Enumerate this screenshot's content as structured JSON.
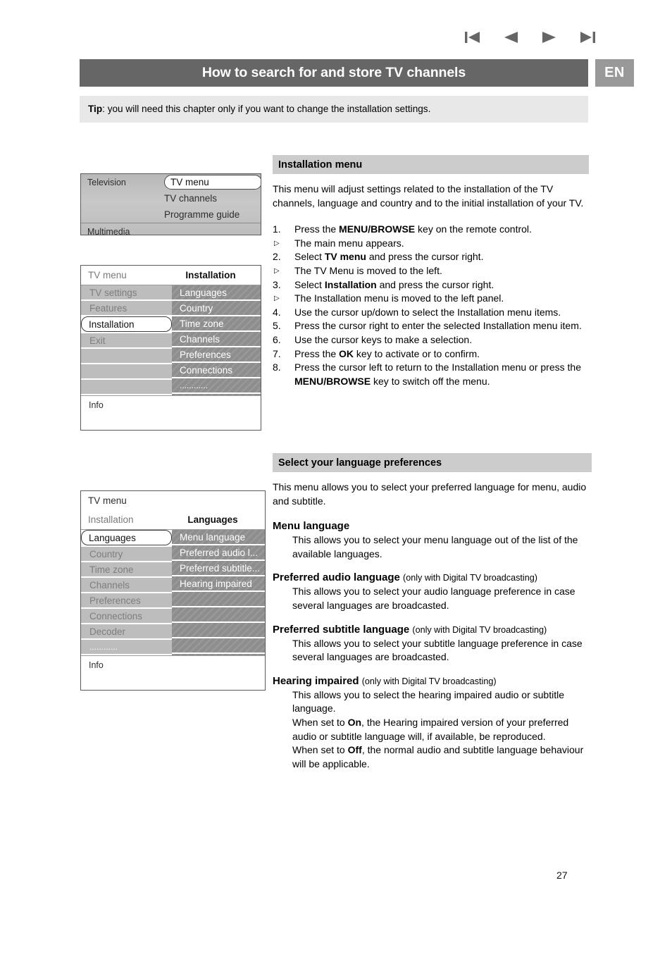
{
  "topnav": {
    "buttons": [
      {
        "name": "skip-back-icon",
        "label": "First page"
      },
      {
        "name": "previous-icon",
        "label": "Previous page"
      },
      {
        "name": "next-icon",
        "label": "Next page"
      },
      {
        "name": "skip-forward-icon",
        "label": "Last page"
      }
    ]
  },
  "header": {
    "title": "How to search for and store TV channels",
    "language_badge": "EN",
    "bar_color": "#666666",
    "badge_color": "#999999"
  },
  "tip": {
    "label": "Tip",
    "separator": ": ",
    "text": "you will need this chapter only if you want to change the installation settings.",
    "background": "#e8e8e8"
  },
  "osd_television": {
    "rows": [
      {
        "left": "Television",
        "right": "TV menu",
        "selected": true
      },
      {
        "left": "",
        "right": "TV channels",
        "selected": false
      },
      {
        "left": "",
        "right": "Programme guide",
        "selected": false
      }
    ],
    "second_group_label": "Multimedia"
  },
  "osd_installation": {
    "title_left": "TV menu",
    "title_right": "Installation",
    "left_items": [
      {
        "label": "TV settings",
        "selected": false
      },
      {
        "label": "Features",
        "selected": false
      },
      {
        "label": "Installation",
        "selected": true
      },
      {
        "label": "Exit",
        "selected": false
      },
      {
        "label": "",
        "selected": false
      },
      {
        "label": "",
        "selected": false
      },
      {
        "label": "",
        "selected": false
      }
    ],
    "right_items": [
      "Languages",
      "Country",
      "Time zone",
      "Channels",
      "Preferences",
      "Connections",
      "............"
    ],
    "info_label": "Info"
  },
  "osd_languages": {
    "title_top": "TV menu",
    "title_left": "Installation",
    "title_right": "Languages",
    "left_items": [
      {
        "label": "Languages",
        "selected": true
      },
      {
        "label": "Country",
        "selected": false
      },
      {
        "label": "Time zone",
        "selected": false
      },
      {
        "label": "Channels",
        "selected": false
      },
      {
        "label": "Preferences",
        "selected": false
      },
      {
        "label": "Connections",
        "selected": false
      },
      {
        "label": "Decoder",
        "selected": false
      },
      {
        "label": "............",
        "selected": false
      }
    ],
    "right_items": [
      "Menu language",
      "Preferred audio l...",
      "Preferred subtitle...",
      "Hearing impaired",
      "",
      "",
      "",
      ""
    ],
    "info_label": "Info"
  },
  "installation_section": {
    "heading": "Installation menu",
    "intro": "This menu will adjust settings related to the installation of the TV channels, language and country and to the initial installation of your TV.",
    "steps": [
      {
        "num": "1.",
        "parts": [
          {
            "text": "Press the ",
            "bold": false
          },
          {
            "text": "MENU/BROWSE",
            "bold": true
          },
          {
            "text": " key on the remote control.",
            "bold": false
          }
        ],
        "sub": "The main menu appears."
      },
      {
        "num": "2.",
        "parts": [
          {
            "text": "Select ",
            "bold": false
          },
          {
            "text": "TV menu",
            "bold": true
          },
          {
            "text": " and press the cursor right.",
            "bold": false
          }
        ],
        "sub": "The TV Menu is moved to the left."
      },
      {
        "num": "3.",
        "parts": [
          {
            "text": "Select ",
            "bold": false
          },
          {
            "text": "Installation",
            "bold": true
          },
          {
            "text": " and press the cursor right.",
            "bold": false
          }
        ],
        "sub": "The Installation menu is moved to the left panel."
      },
      {
        "num": "4.",
        "parts": [
          {
            "text": "Use the cursor up/down to select the Installation menu items.",
            "bold": false
          }
        ],
        "sub": ""
      },
      {
        "num": "5.",
        "parts": [
          {
            "text": "Press the cursor right to enter the selected Installation menu item.",
            "bold": false
          }
        ],
        "sub": ""
      },
      {
        "num": "6.",
        "parts": [
          {
            "text": "Use the cursor keys to make a selection.",
            "bold": false
          }
        ],
        "sub": ""
      },
      {
        "num": "7.",
        "parts": [
          {
            "text": "Press the ",
            "bold": false
          },
          {
            "text": "OK",
            "bold": true
          },
          {
            "text": " key to activate or to confirm.",
            "bold": false
          }
        ],
        "sub": ""
      },
      {
        "num": "8.",
        "parts": [
          {
            "text": "Press the cursor left to return to the Installation menu or press the ",
            "bold": false
          },
          {
            "text": "MENU/BROWSE",
            "bold": true
          },
          {
            "text": " key to switch off the menu.",
            "bold": false
          }
        ],
        "sub": ""
      }
    ]
  },
  "language_section": {
    "heading": "Select your language preferences",
    "intro": "This menu allows you to select your preferred language for menu, audio and subtitle.",
    "definitions": [
      {
        "term": "Menu language",
        "note": "",
        "body": [
          {
            "parts": [
              {
                "text": "This allows you to select your menu language out of the list of the available languages.",
                "bold": false
              }
            ]
          }
        ]
      },
      {
        "term": "Preferred audio language",
        "note": "(only with Digital TV broadcasting)",
        "body": [
          {
            "parts": [
              {
                "text": "This allows you to select your audio language preference in case several languages are broadcasted.",
                "bold": false
              }
            ]
          }
        ]
      },
      {
        "term": "Preferred subtitle language",
        "note": "(only with Digital TV broadcasting)",
        "body": [
          {
            "parts": [
              {
                "text": "This allows you to select your subtitle language preference in case several languages are broadcasted.",
                "bold": false
              }
            ]
          }
        ]
      },
      {
        "term": "Hearing impaired",
        "note": "(only with Digital TV broadcasting)",
        "body": [
          {
            "parts": [
              {
                "text": "This allows you to select the hearing impaired audio or subtitle language.",
                "bold": false
              }
            ]
          },
          {
            "parts": [
              {
                "text": "When set to ",
                "bold": false
              },
              {
                "text": "On",
                "bold": true
              },
              {
                "text": ", the Hearing impaired version of your preferred audio or subtitle language will, if available, be reproduced.",
                "bold": false
              }
            ]
          },
          {
            "parts": [
              {
                "text": "When set to ",
                "bold": false
              },
              {
                "text": "Off",
                "bold": true
              },
              {
                "text": ", the normal audio and subtitle language behaviour will be applicable.",
                "bold": false
              }
            ]
          }
        ]
      }
    ]
  },
  "footer": {
    "page_number": "27"
  }
}
